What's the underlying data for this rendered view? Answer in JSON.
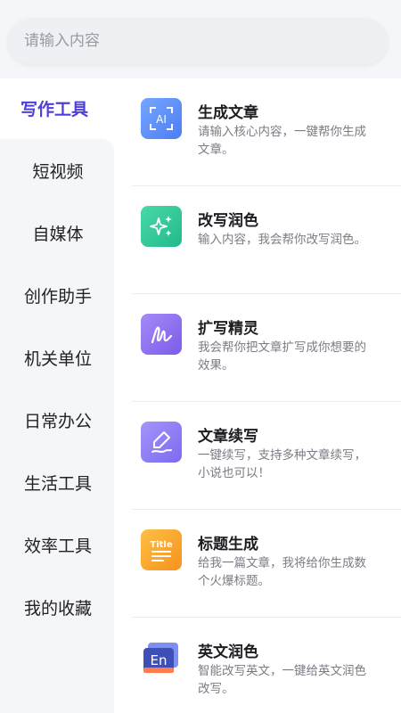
{
  "search": {
    "placeholder": "请输入内容"
  },
  "sidebar": {
    "items": [
      {
        "label": "写作工具",
        "active": true
      },
      {
        "label": "短视频"
      },
      {
        "label": "自媒体"
      },
      {
        "label": "创作助手"
      },
      {
        "label": "机关单位"
      },
      {
        "label": "日常办公"
      },
      {
        "label": "生活工具"
      },
      {
        "label": "效率工具"
      },
      {
        "label": "我的收藏"
      }
    ]
  },
  "tools": [
    {
      "title": "生成文章",
      "desc": "请输入核心内容，一键帮你生成文章。",
      "icon": "ai-icon",
      "color": "#5b8ff7",
      "icon_text": "AI"
    },
    {
      "title": "改写润色",
      "desc": "输入内容，我会帮你改写润色。",
      "icon": "sparkle-icon",
      "color": "#2fc39a"
    },
    {
      "title": "扩写精灵",
      "desc": "我会帮你把文章扩写成你想要的效果。",
      "icon": "script-icon",
      "color": "#8c6cf0"
    },
    {
      "title": "文章续写",
      "desc": "一键续写，支持多种文章续写，小说也可以！",
      "icon": "pen-icon",
      "color": "#8c7cf7"
    },
    {
      "title": "标题生成",
      "desc": "给我一篇文章，我将给你生成数个火爆标题。",
      "icon": "title-icon",
      "color": "#f9a52c",
      "icon_text": "Title"
    },
    {
      "title": "英文润色",
      "desc": "智能改写英文，一键给英文润色改写。",
      "icon": "english-icon",
      "color": "#4a5bc4",
      "icon_text": "En"
    }
  ]
}
